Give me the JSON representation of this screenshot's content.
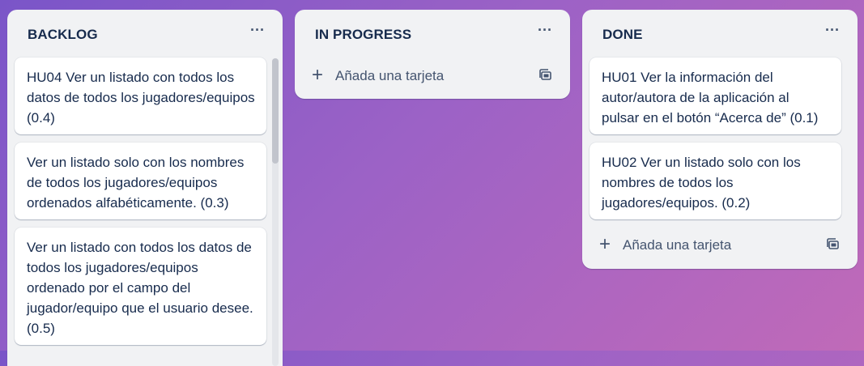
{
  "board": {
    "lists": [
      {
        "title": "BACKLOG",
        "menu_label": "···",
        "cards": [
          "HU04 Ver un listado con todos los datos de todos los jugadores/equipos (0.4)",
          "Ver un listado solo con los nombres de todos los jugadores/equipos ordenados alfabéticamente. (0.3)",
          "Ver un listado con todos los datos de todos los jugadores/equipos ordenado por el campo del jugador/equipo que el usuario desee. (0.5)"
        ]
      },
      {
        "title": "IN PROGRESS",
        "menu_label": "···",
        "cards": [],
        "add_card_label": "Añada una tarjeta"
      },
      {
        "title": "DONE",
        "menu_label": "···",
        "cards": [
          "HU01 Ver la información del autor/autora de la aplicación al pulsar en el botón “Acerca de” (0.1)",
          "HU02 Ver un listado solo con los nombres de todos los jugadores/equipos. (0.2)"
        ],
        "add_card_label": "Añada una tarjeta"
      }
    ]
  },
  "icons": {
    "add": "plus-icon",
    "template": "card-template-icon",
    "menu": "more-horizontal-icon"
  },
  "colors": {
    "background_start": "#7a55c8",
    "background_end": "#c06ab8",
    "list_bg": "#f1f2f4",
    "card_bg": "#ffffff",
    "text": "#172b4d",
    "subtle_text": "#44546f"
  },
  "glyphs": {
    "plus": "+"
  }
}
